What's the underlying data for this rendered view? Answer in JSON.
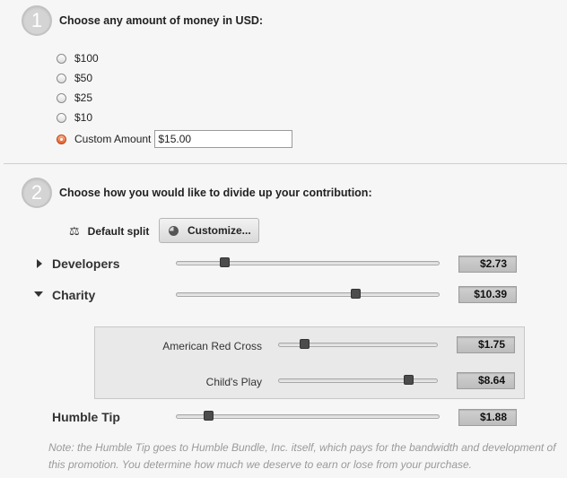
{
  "step1": {
    "number": "1",
    "heading": "Choose any amount of money in USD:",
    "options": [
      {
        "label": "$100",
        "checked": false
      },
      {
        "label": "$50",
        "checked": false
      },
      {
        "label": "$25",
        "checked": false
      },
      {
        "label": "$10",
        "checked": false
      },
      {
        "label": "Custom Amount",
        "checked": true
      }
    ],
    "custom_value": "$15.00"
  },
  "step2": {
    "number": "2",
    "heading": "Choose how you would like to divide up your contribution:",
    "default_split_label": "Default split",
    "customize_label": "Customize...",
    "rows": {
      "developers": {
        "label": "Developers",
        "value": "$2.73",
        "fraction": 0.18
      },
      "charity": {
        "label": "Charity",
        "value": "$10.39",
        "fraction": 0.68
      },
      "tip": {
        "label": "Humble Tip",
        "value": "$1.88",
        "fraction": 0.12
      }
    },
    "charities": {
      "red_cross": {
        "label": "American Red Cross",
        "value": "$1.75",
        "fraction": 0.16
      },
      "childs_play": {
        "label": "Child's Play",
        "value": "$8.64",
        "fraction": 0.82
      }
    }
  },
  "note": "Note: the Humble Tip goes to Humble Bundle, Inc. itself, which pays for the bandwidth and development of this promotion. You determine how much we deserve to earn or lose from your purchase."
}
